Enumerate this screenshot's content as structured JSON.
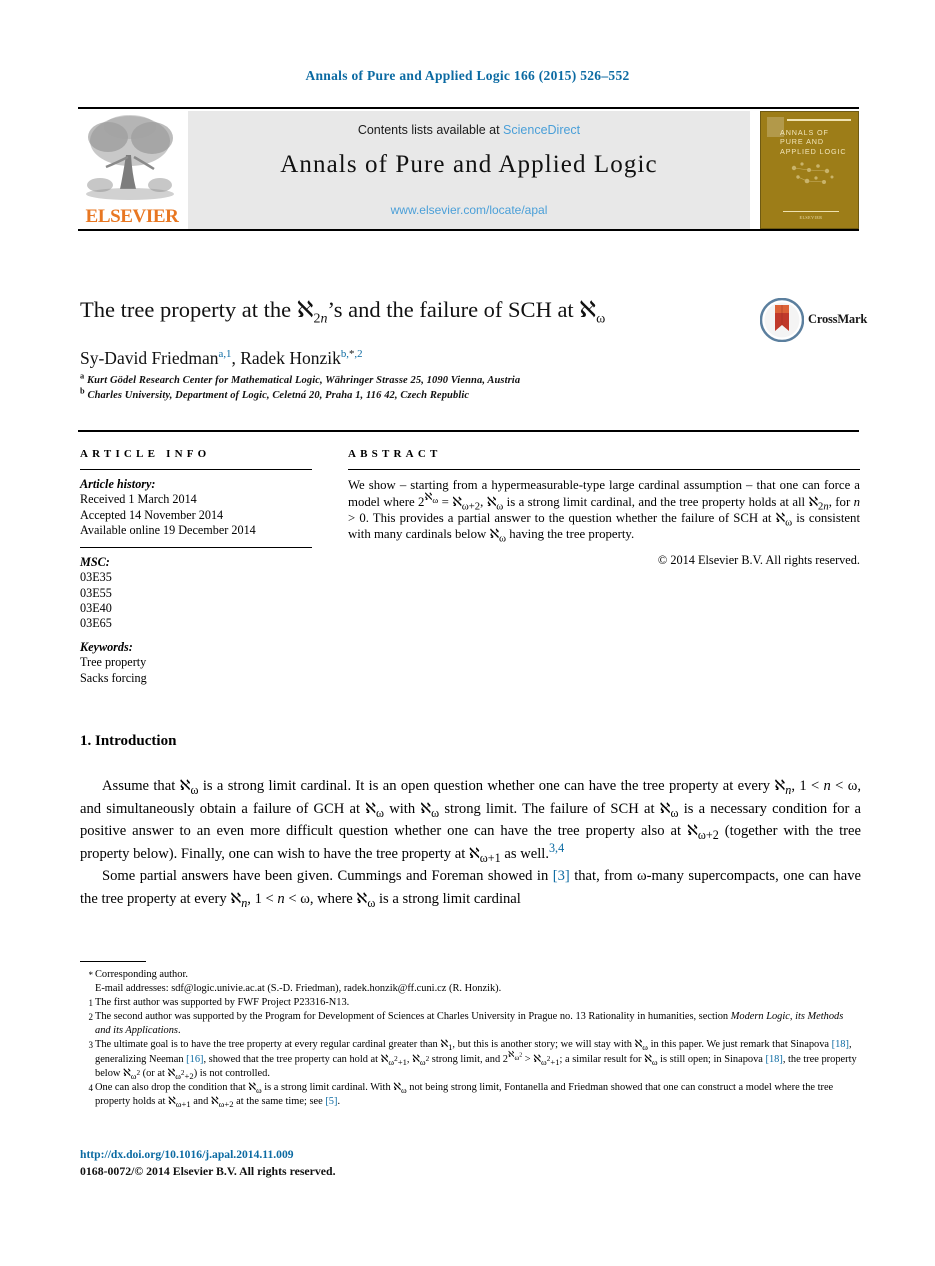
{
  "running_head": "Annals of Pure and Applied Logic 166 (2015) 526–552",
  "masthead": {
    "contents_prefix": "Contents lists available at ",
    "sciencedirect": "ScienceDirect",
    "journal_title": "Annals of Pure and Applied Logic",
    "journal_url": "www.elsevier.com/locate/apal",
    "elsevier_wordmark": "ELSEVIER",
    "cover_title": "ANNALS OF PURE AND APPLIED LOGIC",
    "cover_footer": "ELSEVIER",
    "colors": {
      "link_blue": "#4a9fd8",
      "elsevier_orange": "#e87722",
      "cover_gold": "#9d7d18",
      "banner_gray": "#e8e8e8"
    }
  },
  "article": {
    "title_html": "The tree property at the &#8501;<sub>2<i>n</i></sub>&#8217;s and the failure of SCH at &#8501;<sub>&#969;</sub>",
    "crossmark_label": "CrossMark",
    "authors_html": "Sy-David Friedman<sup>a,1</sup>, Radek Honzik<sup>b,<span class=\"blk\">*</span>,2</sup>",
    "affiliation_a": "Kurt Gödel Research Center for Mathematical Logic, Währinger Strasse 25, 1090 Vienna, Austria",
    "affiliation_b": "Charles University, Department of Logic, Celetná 20, Praha 1, 116 42, Czech Republic",
    "affiliation_a_mark": "a",
    "affiliation_b_mark": "b"
  },
  "info": {
    "heading": "ARTICLE INFO",
    "history_label": "Article history:",
    "history": [
      "Received 1 March 2014",
      "Accepted 14 November 2014",
      "Available online 19 December 2014"
    ],
    "msc_label": "MSC:",
    "msc": [
      "03E35",
      "03E55",
      "03E40",
      "03E65"
    ],
    "keywords_label": "Keywords:",
    "keywords": [
      "Tree property",
      "Sacks forcing"
    ]
  },
  "abstract": {
    "heading": "ABSTRACT",
    "body_html": "We show &#8211; starting from a hypermeasurable-type large cardinal assumption &#8211; that one can force a model where 2<sup>&#8501;<sub>&#969;</sub></sup> = &#8501;<sub>&#969;+2</sub>, &#8501;<sub>&#969;</sub> is a strong limit cardinal, and the tree property holds at all &#8501;<sub>2<i>n</i></sub>, for <i>n</i> &gt; 0. This provides a partial answer to the question whether the failure of SCH at &#8501;<sub>&#969;</sub> is consistent with many cardinals below &#8501;<sub>&#969;</sub> having the tree property.",
    "copyright": "© 2014 Elsevier B.V. All rights reserved."
  },
  "section": {
    "heading": "1. Introduction",
    "paragraph1_html": "Assume that &#8501;<sub>&#969;</sub> is a strong limit cardinal. It is an open question whether one can have the tree property at every &#8501;<sub><i>n</i></sub>, 1 &lt; <i>n</i> &lt; &#969;, and simultaneously obtain a failure of GCH at &#8501;<sub>&#969;</sub> with &#8501;<sub>&#969;</sub> strong limit. The failure of SCH at &#8501;<sub>&#969;</sub> is a necessary condition for a positive answer to an even more difficult question whether one can have the tree property also at &#8501;<sub>&#969;+2</sub> (together with the tree property below). Finally, one can wish to have the tree property at &#8501;<sub>&#969;+1</sub> as well.<sup class=\"cite\">3,4</sup>",
    "paragraph2_html": "Some partial answers have been given. Cummings and Foreman showed in <span class=\"cite\">[3]</span> that, from &#969;-many supercompacts, one can have the tree property at every &#8501;<sub><i>n</i></sub>, 1 &lt; <i>n</i> &lt; &#969;, where &#8501;<sub>&#969;</sub> is a strong limit cardinal"
  },
  "footnotes": {
    "corresponding_mark": "*",
    "corresponding_text": "Corresponding author.",
    "email_label": "E-mail addresses:",
    "email_1": "sdf@logic.univie.ac.at",
    "email_1_owner": "(S.-D. Friedman),",
    "email_2": "radek.honzik@ff.cuni.cz",
    "email_2_owner": "(R. Honzik).",
    "note_1_mark": "1",
    "note_1_html": "The first author was supported by FWF Project P23316-N13.",
    "note_2_mark": "2",
    "note_2_html": "The second author was supported by the Program for Development of Sciences at Charles University in Prague no. 13 Rationality in humanities, section <span class=\"it\">Modern Logic, its Methods and its Applications</span>.",
    "note_3_mark": "3",
    "note_3_html": "The ultimate goal is to have the tree property at every regular cardinal greater than &#8501;<sub>1</sub>, but this is another story; we will stay with &#8501;<sub>&#969;</sub> in this paper. We just remark that Sinapova <span class=\"link\">[18]</span>, generalizing Neeman <span class=\"link\">[16]</span>, showed that the tree property can hold at &#8501;<sub>&#969;<sup>2</sup>+1</sub>, &#8501;<sub>&#969;<sup>2</sup></sub> strong limit, and 2<sup>&#8501;<sub>&#969;<sup>2</sup></sub></sup> &gt; &#8501;<sub>&#969;<sup>2</sup>+1</sub>; a similar result for &#8501;<sub>&#969;</sub> is still open; in Sinapova <span class=\"link\">[18]</span>, the tree property below &#8501;<sub>&#969;<sup>2</sup></sub> (or at &#8501;<sub>&#969;<sup>2</sup>+2</sub>) is not controlled.",
    "note_4_mark": "4",
    "note_4_html": "One can also drop the condition that &#8501;<sub>&#969;</sub> is a strong limit cardinal. With &#8501;<sub>&#969;</sub> not being strong limit, Fontanella and Friedman showed that one can construct a model where the tree property holds at &#8501;<sub>&#969;+1</sub> and &#8501;<sub>&#969;+2</sub> at the same time; see <span class=\"link\">[5]</span>."
  },
  "footer": {
    "doi": "http://dx.doi.org/10.1016/j.apal.2014.11.009",
    "issn": "0168-0072/© 2014 Elsevier B.V. All rights reserved."
  }
}
